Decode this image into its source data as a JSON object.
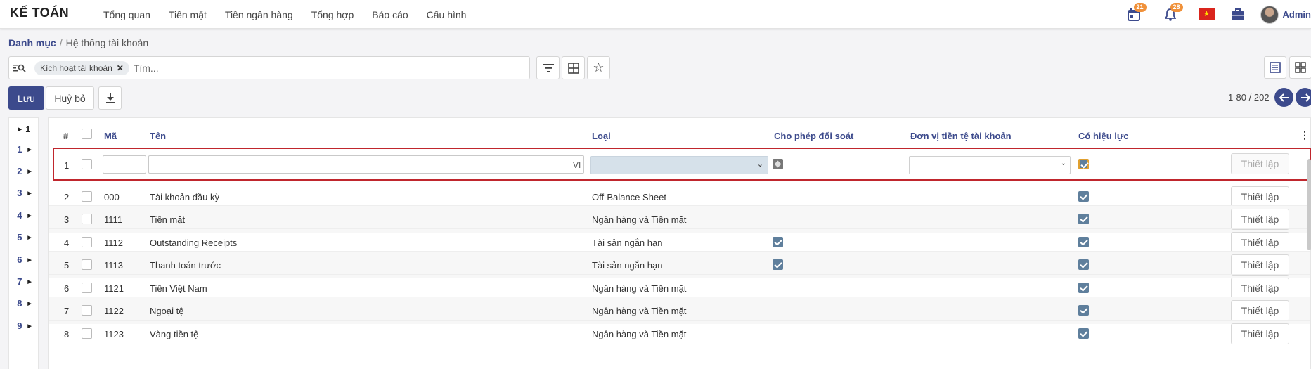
{
  "navbar": {
    "brand": "KẾ TOÁN",
    "menu": [
      "Tổng quan",
      "Tiền mặt",
      "Tiền ngân hàng",
      "Tổng hợp",
      "Báo cáo",
      "Cấu hình"
    ],
    "calendar_badge": "21",
    "notification_badge": "28",
    "user_name": "Admin"
  },
  "breadcrumb": {
    "parent": "Danh mục",
    "separator": "/",
    "current": "Hệ thống tài khoản"
  },
  "search": {
    "facet_label": "Kích hoạt tài khoản",
    "placeholder": "Tìm..."
  },
  "actions": {
    "save_label": "Lưu",
    "cancel_label": "Huỷ bỏ"
  },
  "pager": {
    "text": "1-80 / 202"
  },
  "gutter": [
    "1",
    "1",
    "2",
    "3",
    "4",
    "5",
    "6",
    "7",
    "8",
    "9"
  ],
  "table": {
    "headers": {
      "num": "#",
      "code": "Mã",
      "name": "Tên",
      "type": "Loại",
      "reconcile": "Cho phép đối soát",
      "currency": "Đơn vị tiền tệ tài khoản",
      "active": "Có hiệu lực"
    },
    "edit_row": {
      "num": "1",
      "code_value": "",
      "name_value": "",
      "lang": "VI",
      "setup_label": "Thiết lập",
      "active": true
    },
    "rows": [
      {
        "num": "2",
        "code": "000",
        "name": "Tài khoản đầu kỳ",
        "type": "Off-Balance Sheet",
        "reconcile": false,
        "active": true,
        "setup_label": "Thiết lập"
      },
      {
        "num": "3",
        "code": "1111",
        "name": "Tiền mặt",
        "type": "Ngân hàng và Tiền mặt",
        "reconcile": false,
        "active": true,
        "setup_label": "Thiết lập"
      },
      {
        "num": "4",
        "code": "1112",
        "name": "Outstanding Receipts",
        "type": "Tài sản ngắn hạn",
        "reconcile": true,
        "active": true,
        "setup_label": "Thiết lập"
      },
      {
        "num": "5",
        "code": "1113",
        "name": "Thanh toán trước",
        "type": "Tài sản ngắn hạn",
        "reconcile": true,
        "active": true,
        "setup_label": "Thiết lập"
      },
      {
        "num": "6",
        "code": "1121",
        "name": "Tiền Việt Nam",
        "type": "Ngân hàng và Tiền mặt",
        "reconcile": false,
        "active": true,
        "setup_label": "Thiết lập"
      },
      {
        "num": "7",
        "code": "1122",
        "name": "Ngoại tệ",
        "type": "Ngân hàng và Tiền mặt",
        "reconcile": false,
        "active": true,
        "setup_label": "Thiết lập"
      },
      {
        "num": "8",
        "code": "1123",
        "name": "Vàng tiền tệ",
        "type": "Ngân hàng và Tiền mặt",
        "reconcile": false,
        "active": true,
        "setup_label": "Thiết lập"
      }
    ]
  },
  "colors": {
    "accent": "#3c4a8c",
    "badge": "#f0913a",
    "checkbox_on": "#5f7f9c",
    "edit_border": "#c0262d"
  }
}
